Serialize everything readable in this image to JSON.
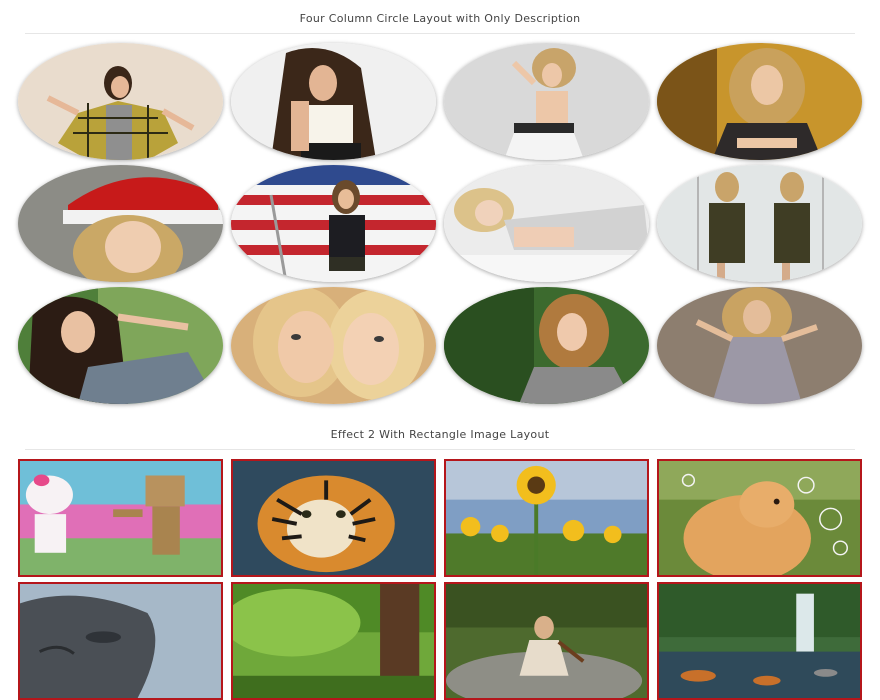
{
  "section1": {
    "title": "Four Column Circle Layout with Only Description",
    "items": [
      {
        "photo": "girl-yellow-plaid-jacket"
      },
      {
        "photo": "girl-white-tank-top"
      },
      {
        "photo": "blonde-girl-white-top"
      },
      {
        "photo": "curly-blonde-black-top"
      },
      {
        "photo": "blonde-santa-hat"
      },
      {
        "photo": "girl-flag-microphone"
      },
      {
        "photo": "blonde-lying-down"
      },
      {
        "photo": "two-girls-camouflage"
      },
      {
        "photo": "brunette-blue-shirt"
      },
      {
        "photo": "two-blondes-closeup"
      },
      {
        "photo": "blonde-forest-grey-top"
      },
      {
        "photo": "blonde-grey-dress"
      }
    ]
  },
  "section2": {
    "title": "Effect 2 With Rectangle Image Layout",
    "items": [
      {
        "photo": "hello-kitty-danbo"
      },
      {
        "photo": "tiger"
      },
      {
        "photo": "sunflowers"
      },
      {
        "photo": "dog-bubbles"
      },
      {
        "photo": "stone-face-sculpture"
      },
      {
        "photo": "green-forest-trees"
      },
      {
        "photo": "violin-girl-rocks"
      },
      {
        "photo": "waterfall-lake"
      }
    ]
  },
  "colors": {
    "accent_border": "#b5161b",
    "title_text": "#444444"
  }
}
